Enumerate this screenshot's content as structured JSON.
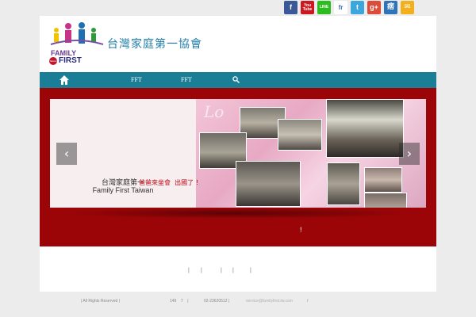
{
  "social": {
    "facebook": "f",
    "youtube": "You Tube",
    "line": "LINE",
    "fr": "fr",
    "twitter": "t",
    "google": "g+",
    "plurk": "痞",
    "mail": "✉"
  },
  "header": {
    "logo_family": "FAMILY",
    "logo_first": "FIRST",
    "logo_badge": "Taiwan",
    "site_title": "台灣家庭第一協會"
  },
  "nav": {
    "home_icon": "home-icon",
    "items": [
      "FFT",
      "FFT"
    ],
    "search_icon": "search-icon"
  },
  "slider": {
    "caption_line1": "台灣家庭第一",
    "caption_line2": "Family First Taiwan",
    "headline": "爸爸來坐會  出國了 ！",
    "prev": "‹",
    "next": "›"
  },
  "hero": {
    "exclamation": "!"
  },
  "content": {
    "separators": [
      "|",
      "|",
      "|",
      "|",
      "|"
    ]
  },
  "footer": {
    "rights": "| All Rights Reserved |",
    "address": "149    7    |",
    "phone": "02-23620512 |",
    "email": "service@familyfirst.tw.com",
    "slash": "/"
  },
  "colors": {
    "nav": "#1a7f96",
    "hero": "#9b0508",
    "title": "#1f7ea8"
  }
}
